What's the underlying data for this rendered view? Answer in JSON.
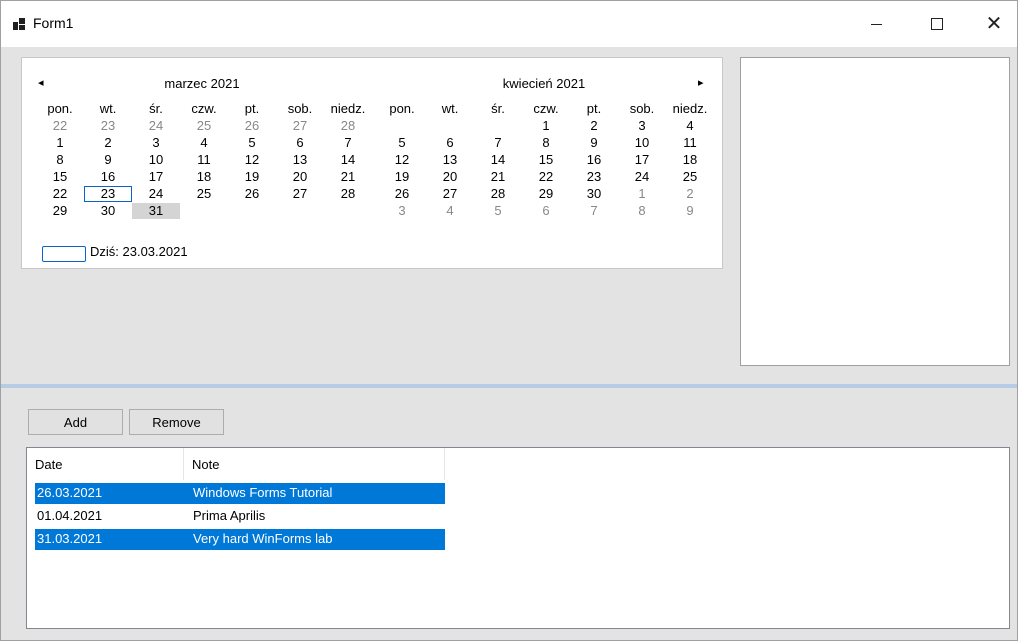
{
  "window": {
    "title": "Form1"
  },
  "calendar": {
    "prev_arrow": "◂",
    "next_arrow": "▸",
    "weekdays": [
      "pon.",
      "wt.",
      "śr.",
      "czw.",
      "pt.",
      "sob.",
      "niedz."
    ],
    "months": [
      {
        "title": "marzec 2021",
        "weeks": [
          [
            "22",
            "23",
            "24",
            "25",
            "26",
            "27",
            "28"
          ],
          [
            "1",
            "2",
            "3",
            "4",
            "5",
            "6",
            "7"
          ],
          [
            "8",
            "9",
            "10",
            "11",
            "12",
            "13",
            "14"
          ],
          [
            "15",
            "16",
            "17",
            "18",
            "19",
            "20",
            "21"
          ],
          [
            "22",
            "23",
            "24",
            "25",
            "26",
            "27",
            "28"
          ],
          [
            "29",
            "30",
            "31",
            "",
            "",
            "",
            ""
          ]
        ],
        "other_month": [
          [
            0,
            0
          ],
          [
            0,
            1
          ],
          [
            0,
            2
          ],
          [
            0,
            3
          ],
          [
            0,
            4
          ],
          [
            0,
            5
          ],
          [
            0,
            6
          ]
        ]
      },
      {
        "title": "kwiecień 2021",
        "weeks": [
          [
            "",
            "",
            "",
            "1",
            "2",
            "3",
            "4"
          ],
          [
            "5",
            "6",
            "7",
            "8",
            "9",
            "10",
            "11"
          ],
          [
            "12",
            "13",
            "14",
            "15",
            "16",
            "17",
            "18"
          ],
          [
            "19",
            "20",
            "21",
            "22",
            "23",
            "24",
            "25"
          ],
          [
            "26",
            "27",
            "28",
            "29",
            "30",
            "1",
            "2"
          ],
          [
            "3",
            "4",
            "5",
            "6",
            "7",
            "8",
            "9"
          ]
        ],
        "other_month": [
          [
            4,
            5
          ],
          [
            4,
            6
          ],
          [
            5,
            0
          ],
          [
            5,
            1
          ],
          [
            5,
            2
          ],
          [
            5,
            3
          ],
          [
            5,
            4
          ],
          [
            5,
            5
          ],
          [
            5,
            6
          ]
        ]
      }
    ],
    "today_label": "Dziś: 23.03.2021",
    "today_day": "23",
    "selected_day": "31"
  },
  "buttons": {
    "add": "Add",
    "remove": "Remove"
  },
  "listview": {
    "columns": [
      "Date",
      "Note"
    ],
    "rows": [
      {
        "date": "26.03.2021",
        "note": "Windows Forms Tutorial",
        "selected": true
      },
      {
        "date": "01.04.2021",
        "note": "Prima Aprilis",
        "selected": false
      },
      {
        "date": "31.03.2021",
        "note": "Very hard WinForms lab",
        "selected": true
      }
    ]
  },
  "colors": {
    "selection": "#0078d7",
    "splitter": "#b8cbe4",
    "today_outline": "#0a64c8"
  }
}
